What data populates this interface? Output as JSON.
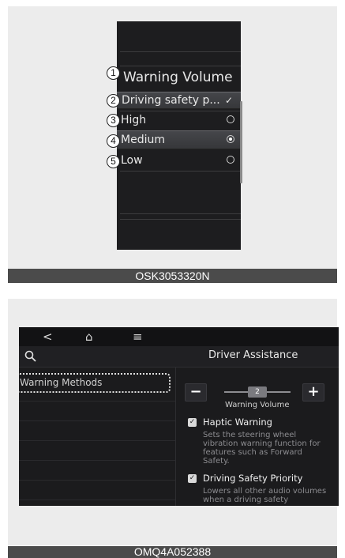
{
  "figure1": {
    "caption": "OSK3053320N",
    "title": "Warning Volume",
    "items": [
      {
        "label": "Driving safety p...",
        "control": "check",
        "checked": true
      },
      {
        "label": "High",
        "control": "radio",
        "selected": false
      },
      {
        "label": "Medium",
        "control": "radio",
        "selected": true
      },
      {
        "label": "Low",
        "control": "radio",
        "selected": false
      }
    ],
    "markers": [
      "1",
      "2",
      "3",
      "4",
      "5"
    ]
  },
  "figure2": {
    "caption": "OMQ4A052388",
    "topbar": {
      "back_icon": "<",
      "home_icon": "⌂",
      "menu_icon": "≡"
    },
    "header": {
      "title": "Driver Assistance",
      "search_icon": "search-icon"
    },
    "left_menu": {
      "selected_label": "Warning Methods"
    },
    "warning_volume": {
      "minus_label": "−",
      "plus_label": "+",
      "value": "2",
      "label": "Warning Volume"
    },
    "options": [
      {
        "title": "Haptic Warning",
        "checked": true,
        "description": "Sets the steering wheel vibration warning function for features such as Forward Safety."
      },
      {
        "title": "Driving Safety Priority",
        "checked": true,
        "description": "Lowers all other audio volumes when a driving safety"
      }
    ],
    "colors": {
      "screen_bg": "#1b1b1d",
      "panel_bg": "#ececec",
      "caption_bg": "#4b4b4b"
    }
  }
}
